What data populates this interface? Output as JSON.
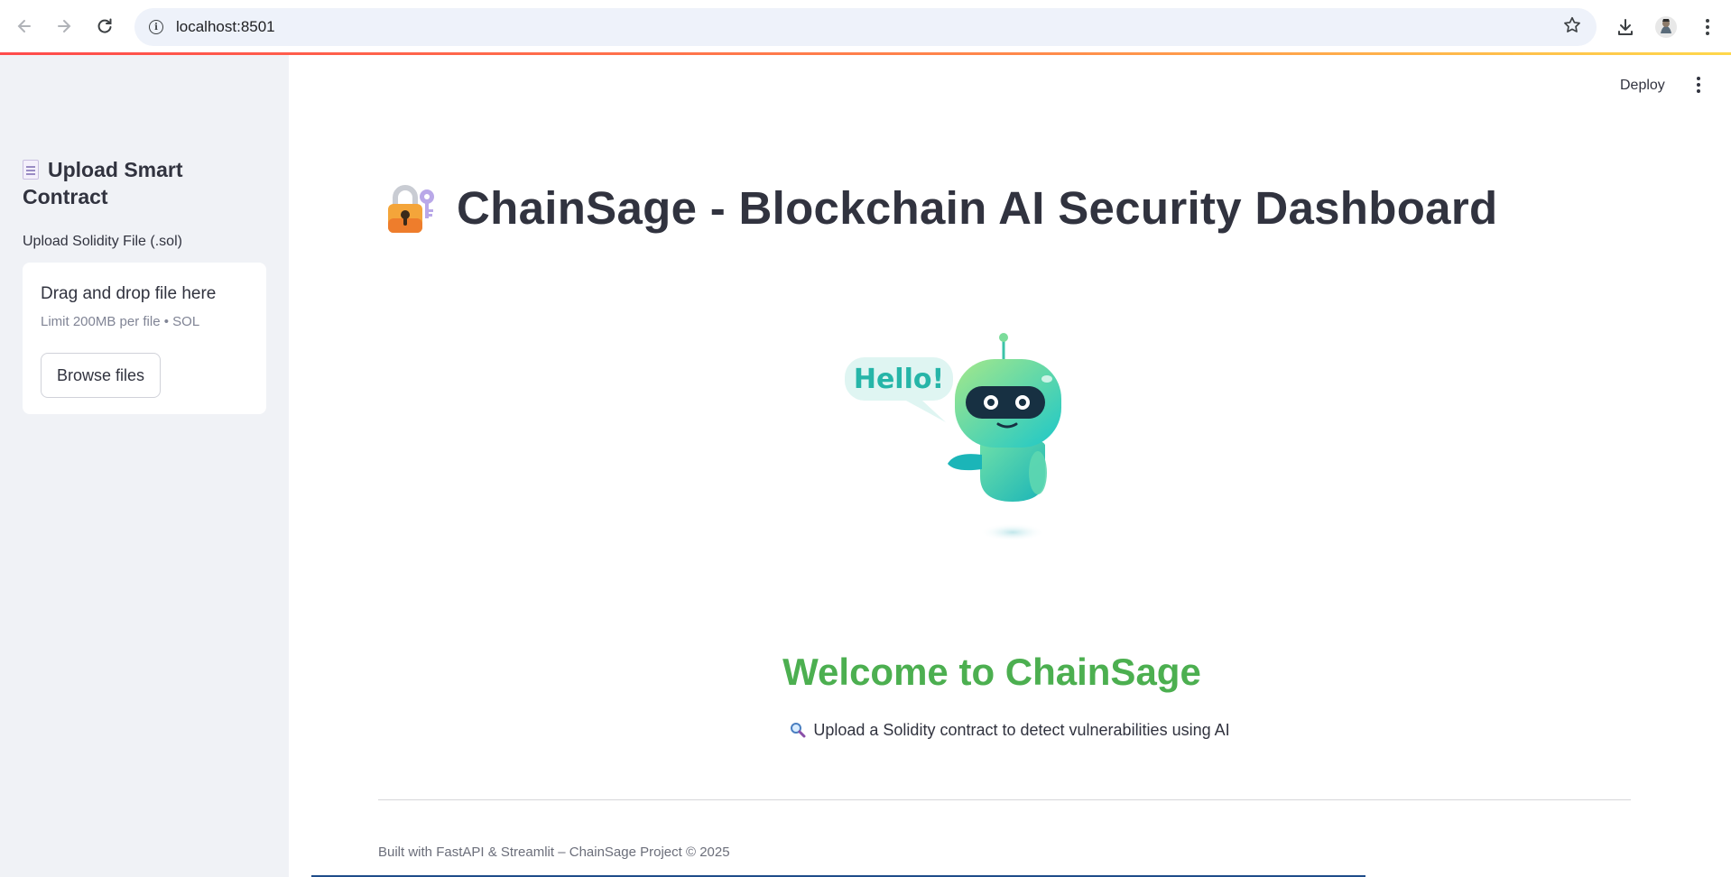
{
  "browser": {
    "url": "localhost:8501",
    "icons": {
      "back": "arrow-left-icon",
      "forward": "arrow-right-icon",
      "reload": "reload-icon",
      "site_info": "info-icon",
      "bookmark": "star-icon",
      "download": "download-icon",
      "profile": "profile-avatar",
      "menu": "kebab-menu-icon"
    }
  },
  "sidebar": {
    "heading": "Upload Smart Contract",
    "heading_icon": "document-icon",
    "uploader": {
      "label": "Upload Solidity File (.sol)",
      "drop_title": "Drag and drop file here",
      "drop_limit": "Limit 200MB per file • SOL",
      "browse_label": "Browse files"
    }
  },
  "header": {
    "deploy_label": "Deploy",
    "menu_icon": "kebab-menu-icon"
  },
  "main": {
    "title": "ChainSage - Blockchain AI Security Dashboard",
    "title_icon": "locked-with-key-icon",
    "illustration": {
      "name": "robot-mascot",
      "speech_text": "Hello!"
    },
    "welcome": "Welcome to ChainSage",
    "subtitle": "Upload a Solidity contract to detect vulnerabilities using AI",
    "subtitle_icon": "magnifying-glass-icon",
    "footer": "Built with FastAPI & Streamlit – ChainSage Project © 2025"
  },
  "colors": {
    "accent_green": "#4caf50",
    "sidebar_bg": "#f0f2f6",
    "text": "#31333f",
    "top_gradient_start": "#ff4b4b",
    "top_gradient_end": "#ffd84b"
  }
}
